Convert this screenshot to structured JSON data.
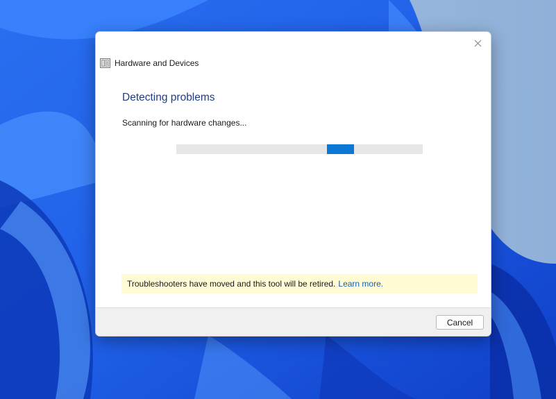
{
  "window": {
    "title": "Hardware and Devices",
    "app_icon": "troubleshooter-icon",
    "close_icon": "close-icon"
  },
  "main": {
    "heading": "Detecting problems",
    "status_text": "Scanning for hardware changes...",
    "progress": {
      "mode": "indeterminate",
      "segment_start_fraction": 0.61,
      "segment_width_fraction": 0.11
    }
  },
  "notice": {
    "text": "Troubleshooters have moved and this tool will be retired.",
    "link_text": "Learn more."
  },
  "footer": {
    "cancel_label": "Cancel"
  },
  "colors": {
    "accent": "#0a78d4",
    "heading": "#1f3f80",
    "link": "#1560b0",
    "notice_bg": "#fefbd5"
  }
}
